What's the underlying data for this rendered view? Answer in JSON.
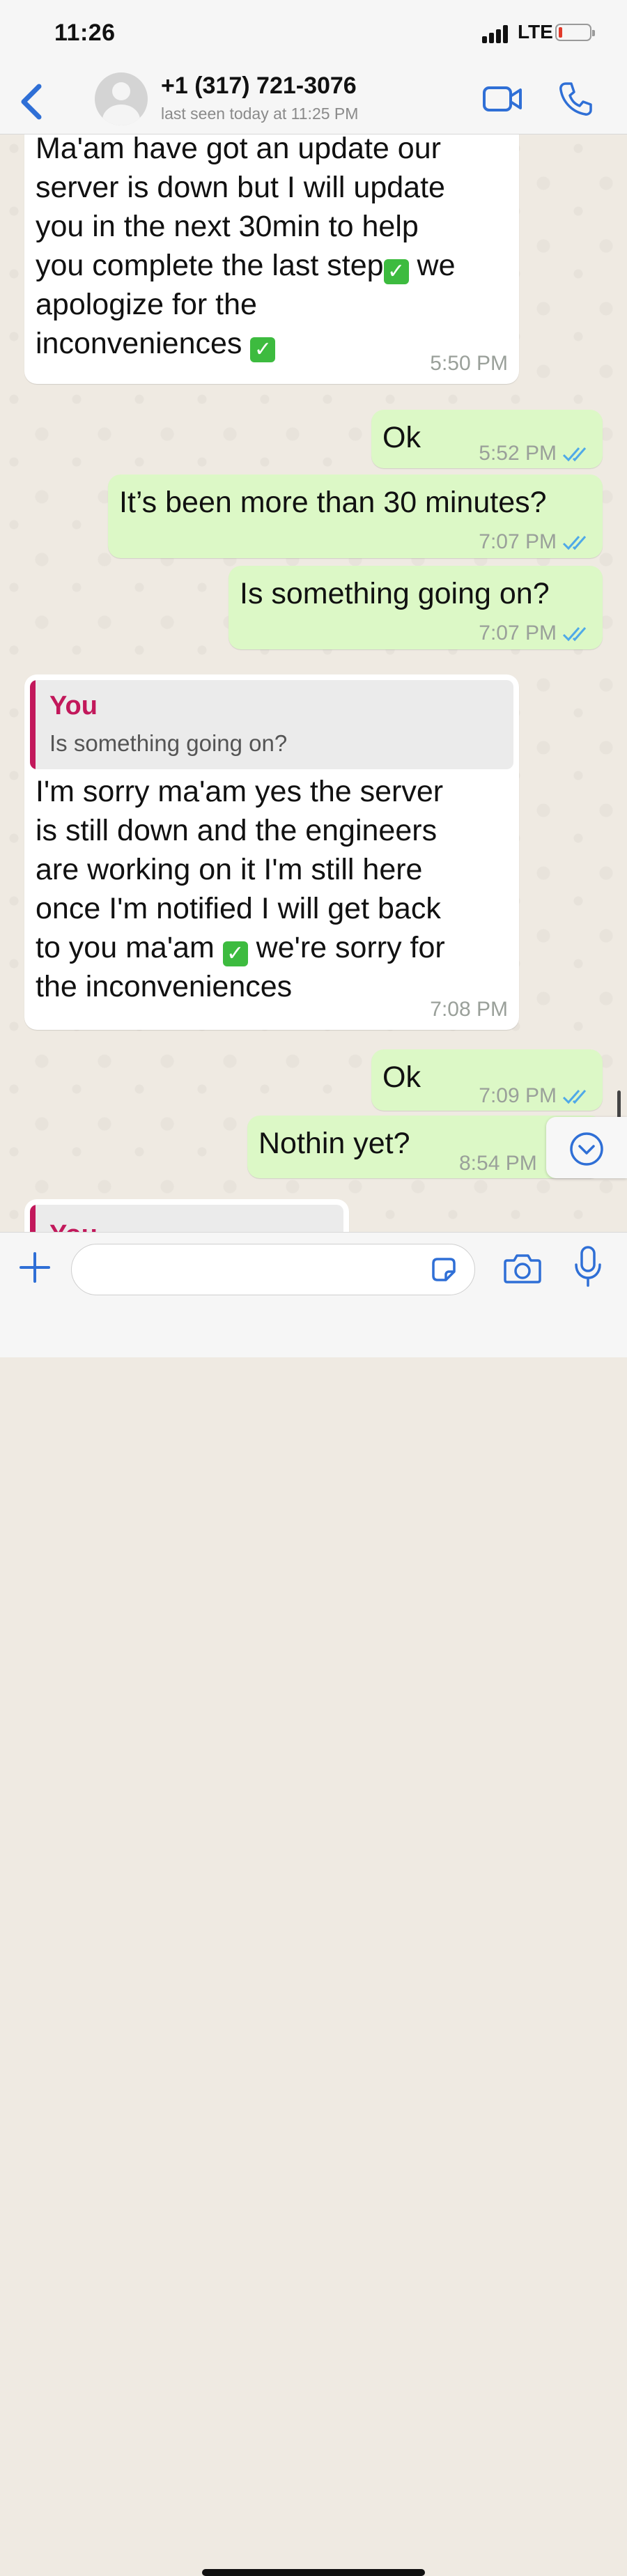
{
  "status_bar": {
    "time": "11:26",
    "network": "LTE",
    "battery_level": 0.08
  },
  "header": {
    "contact_name": "+1 (317) 721-3076",
    "last_seen": "last seen today at 11:25 PM",
    "icons": [
      "chevron-left-icon",
      "avatar",
      "video-camera-icon",
      "phone-icon"
    ]
  },
  "messages": [
    {
      "direction": "incoming",
      "lines": [
        "Ma'am have got an update our",
        "server is down but I will update",
        "you in the next 30min to help",
        "you complete the last step",
        "apologize for the",
        "inconveniences"
      ],
      "line4_tail": " we",
      "time": "5:50 PM"
    },
    {
      "direction": "outgoing",
      "text": "Ok",
      "time": "5:52 PM"
    },
    {
      "direction": "outgoing",
      "text": "It’s been more than 30 minutes?",
      "time": "7:07 PM"
    },
    {
      "direction": "outgoing",
      "text": "Is something going on?",
      "time": "7:07 PM"
    },
    {
      "direction": "incoming",
      "quote_author": "You",
      "quote_text": "Is something going on?",
      "lines": [
        "I'm sorry ma'am yes the server",
        "is still down and the engineers",
        "are working on it I'm still here",
        "once I'm notified I will get back",
        "to you ma'am",
        "the inconveniences"
      ],
      "line5_tail": " we're sorry for",
      "time": "7:08 PM"
    },
    {
      "direction": "outgoing",
      "text": "Ok",
      "time": "7:09 PM"
    },
    {
      "direction": "outgoing",
      "text": "Nothin yet?",
      "time": "8:54 PM"
    },
    {
      "direction": "incoming",
      "quote_author": "You"
    }
  ],
  "input": {
    "placeholder": ""
  },
  "colors": {
    "accent": "#2f6fd6",
    "outgoing_bubble": "#dcf8c6",
    "incoming_bubble": "#ffffff",
    "quote_author": "#c2185b",
    "read_ticks": "#4fa9e8"
  }
}
